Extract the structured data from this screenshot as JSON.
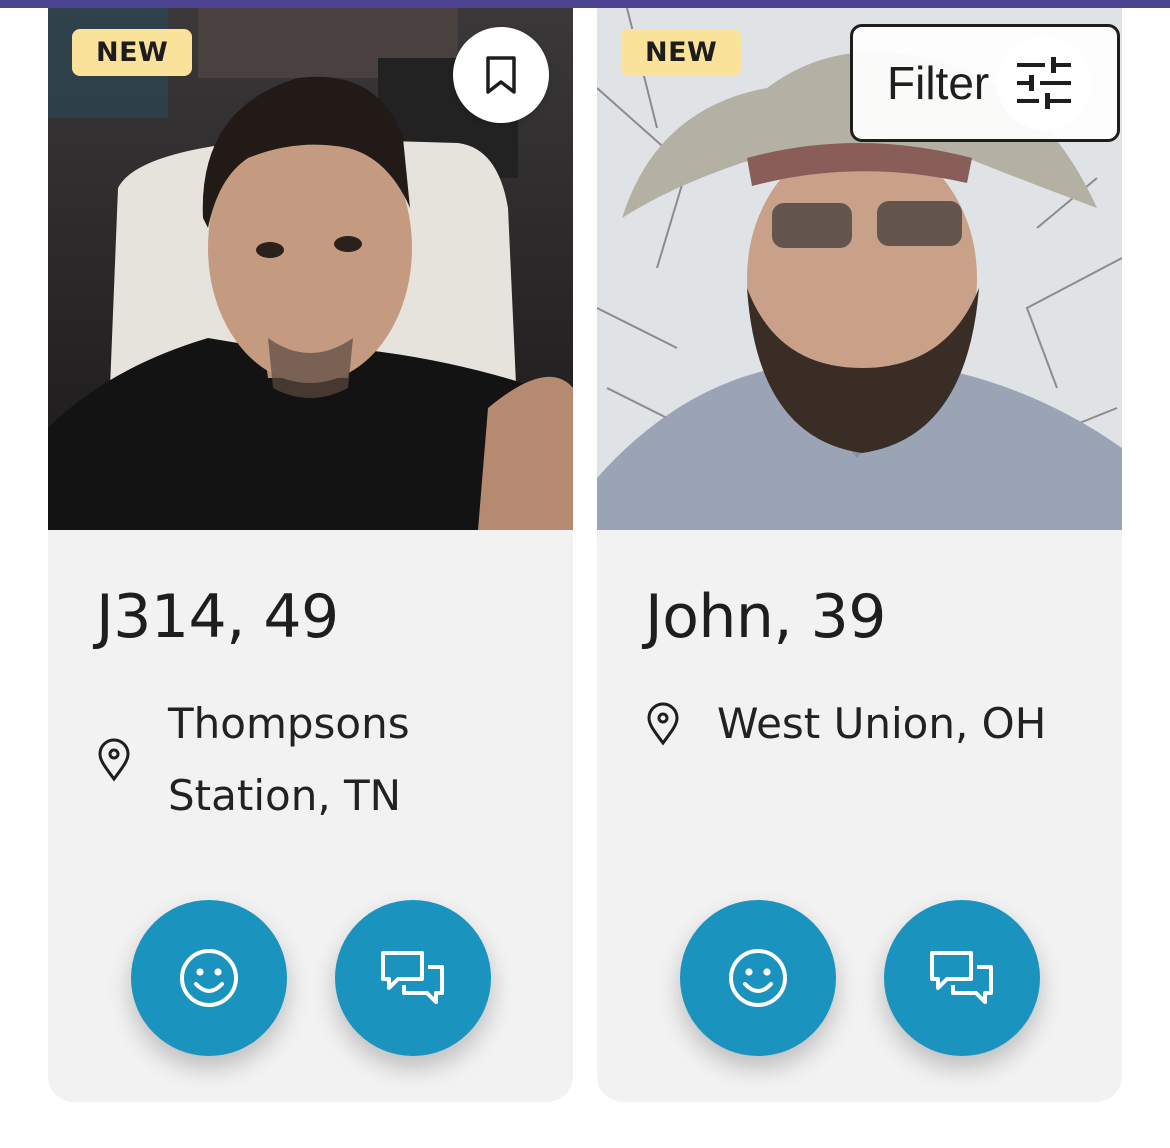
{
  "colors": {
    "top_bar": "#4b4390",
    "badge_bg": "#fbe29a",
    "card_bg": "#f2f2f2",
    "action_button": "#1a93bf",
    "text": "#1e1e1e"
  },
  "filter": {
    "label": "Filter",
    "icon": "sliders-icon"
  },
  "profiles": [
    {
      "badge": "NEW",
      "name_age": "J314, 49",
      "location": "Thompsons Station, TN",
      "has_bookmark": true,
      "actions": [
        "smile-icon",
        "chat-icon"
      ]
    },
    {
      "badge": "NEW",
      "name_age": "John, 39",
      "location": "West Union, OH",
      "actions": [
        "smile-icon",
        "chat-icon"
      ]
    }
  ]
}
